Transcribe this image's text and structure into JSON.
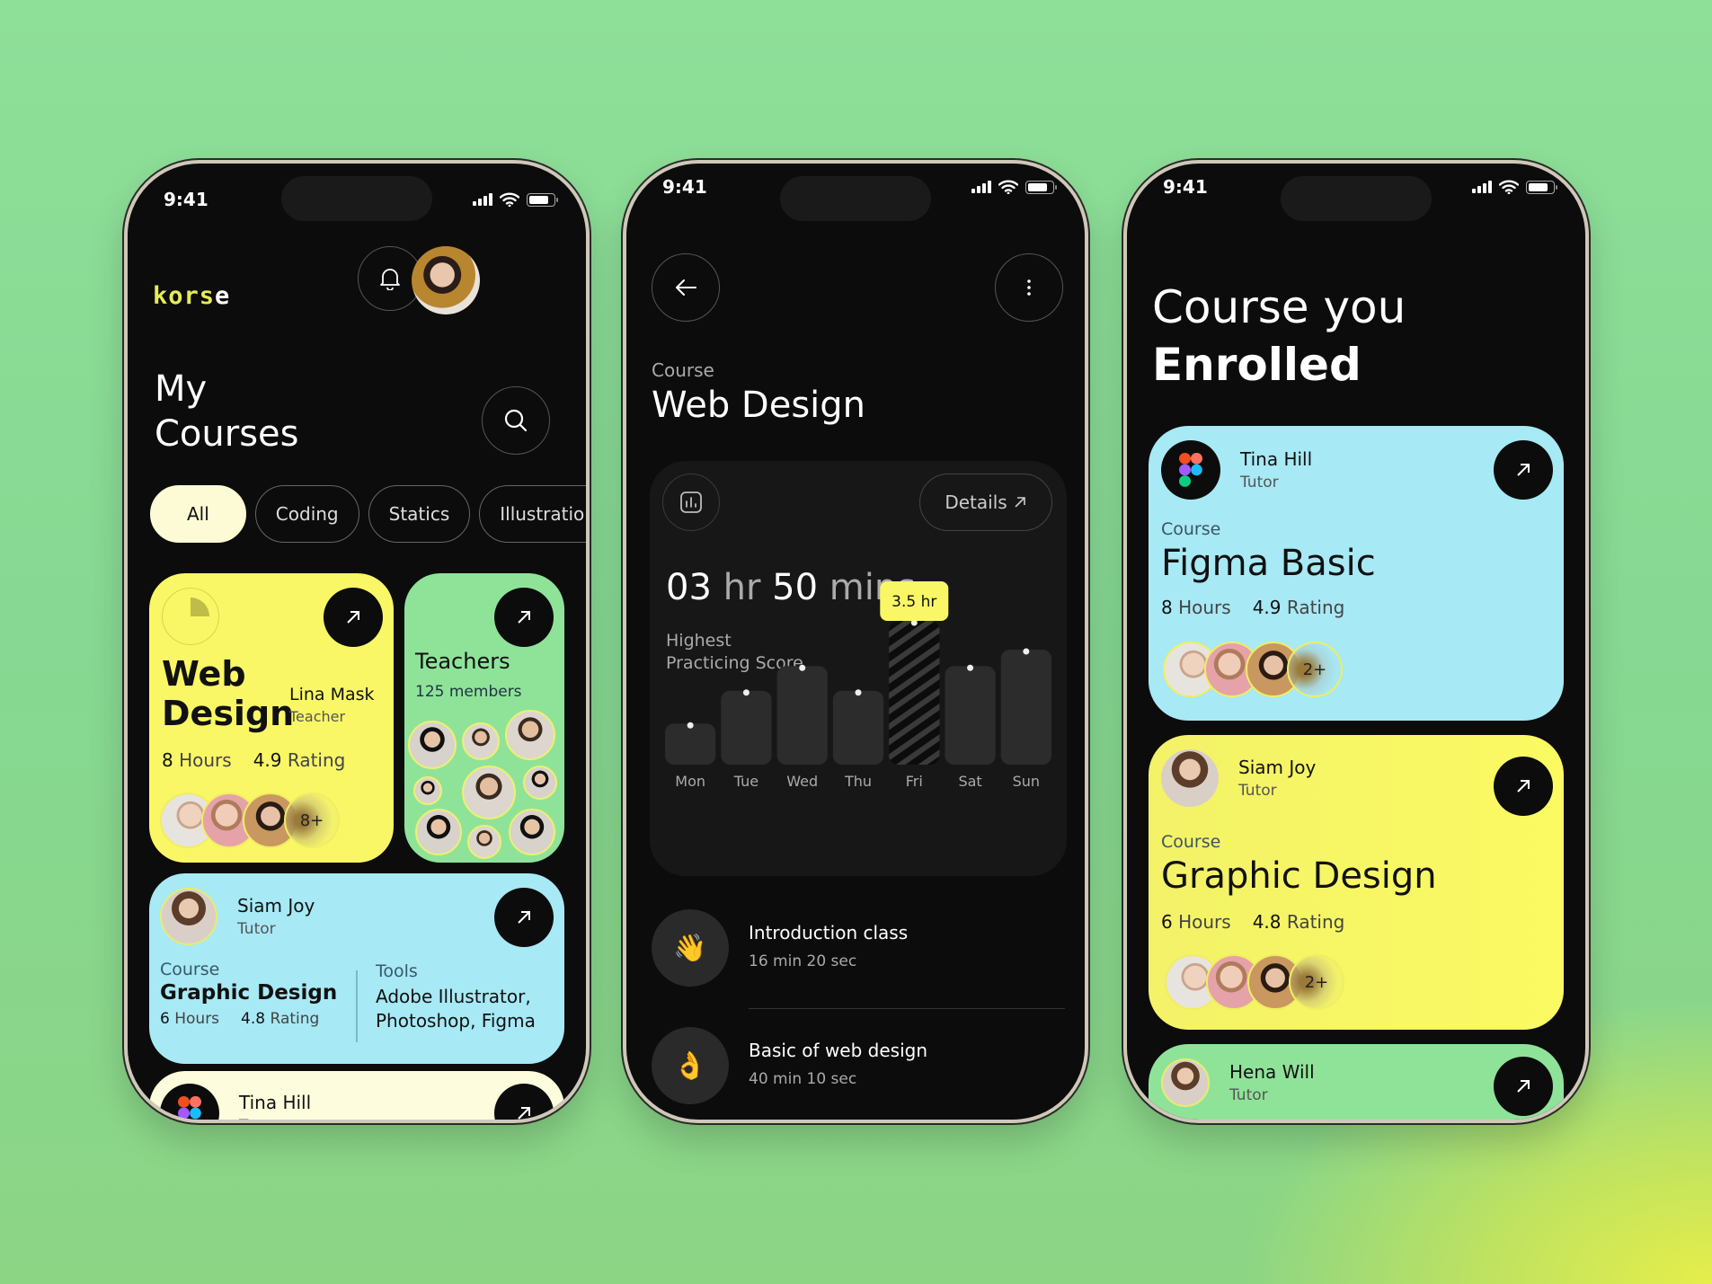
{
  "status_bar": {
    "time": "9:41"
  },
  "screen1": {
    "logo": {
      "part1": "kors",
      "part2": "e"
    },
    "title_line1": "My",
    "title_line2": "Courses",
    "filters": [
      {
        "label": "All",
        "active": true
      },
      {
        "label": "Coding",
        "active": false
      },
      {
        "label": "Statics",
        "active": false
      },
      {
        "label": "Illustration",
        "active": false
      }
    ],
    "web_design_card": {
      "progress_percent": 25,
      "title_line1": "Web",
      "title_line2": "Design",
      "teacher_name": "Lina Mask",
      "teacher_role": "Teacher",
      "hours_num": "8",
      "hours_label": "Hours",
      "rating_num": "4.9",
      "rating_label": "Rating",
      "more_students": "8+",
      "color": "#f9f766"
    },
    "teachers_card": {
      "title": "Teachers",
      "count_num": "125",
      "count_label": "members",
      "color": "#8fe399"
    },
    "graphic_card": {
      "tutor_name": "Siam Joy",
      "tutor_role": "Tutor",
      "course_label": "Course",
      "course_name": "Graphic Design",
      "hours_num": "6",
      "hours_label": "Hours",
      "rating_num": "4.8",
      "rating_label": "Rating",
      "tools_label": "Tools",
      "tools_line1": "Adobe Illustrator,",
      "tools_line2": "Photoshop, Figma",
      "color": "#a7e9f5"
    },
    "tina_card": {
      "tutor_name": "Tina Hill",
      "tutor_role": "Tutor",
      "color": "#fdfcdc"
    }
  },
  "screen2": {
    "course_label": "Course",
    "course_title": "Web Design",
    "details_label": "Details",
    "time_hr_num": "03",
    "time_hr_unit": "hr",
    "time_min_num": "50",
    "time_min_unit": "mins",
    "highest_line1": "Highest",
    "highest_line2": "Practicing Score",
    "lessons": [
      {
        "icon": "👋",
        "title": "Introduction class",
        "duration": "16 min 20 sec"
      },
      {
        "icon": "👌",
        "title": "Basic of web design",
        "duration": "40 min 10 sec"
      }
    ]
  },
  "chart_data": {
    "type": "bar",
    "title": "Highest Practicing Score",
    "categories": [
      "Mon",
      "Tue",
      "Wed",
      "Thu",
      "Fri",
      "Sat",
      "Sun"
    ],
    "values": [
      1.0,
      1.8,
      2.4,
      1.8,
      3.5,
      2.4,
      2.8
    ],
    "unit": "hr",
    "highlighted_index": 4,
    "highlight_label": "3.5 hr",
    "ylim": [
      0,
      3.5
    ],
    "grid": false,
    "xlabel": "",
    "ylabel": ""
  },
  "screen3": {
    "title_line1": "Course you",
    "title_line2": "Enrolled",
    "cards": [
      {
        "tutor_name": "Tina Hill",
        "tutor_role": "Tutor",
        "course_label": "Course",
        "course_name": "Figma Basic",
        "hours_num": "8",
        "hours_label": "Hours",
        "rating_num": "4.9",
        "rating_label": "Rating",
        "more_students": "2+",
        "color": "#a7e9f5"
      },
      {
        "tutor_name": "Siam Joy",
        "tutor_role": "Tutor",
        "course_label": "Course",
        "course_name": "Graphic Design",
        "hours_num": "6",
        "hours_label": "Hours",
        "rating_num": "4.8",
        "rating_label": "Rating",
        "more_students": "2+",
        "color": "#f9f766"
      },
      {
        "tutor_name": "Hena Will",
        "tutor_role": "Tutor",
        "color": "#8fe399"
      }
    ]
  }
}
